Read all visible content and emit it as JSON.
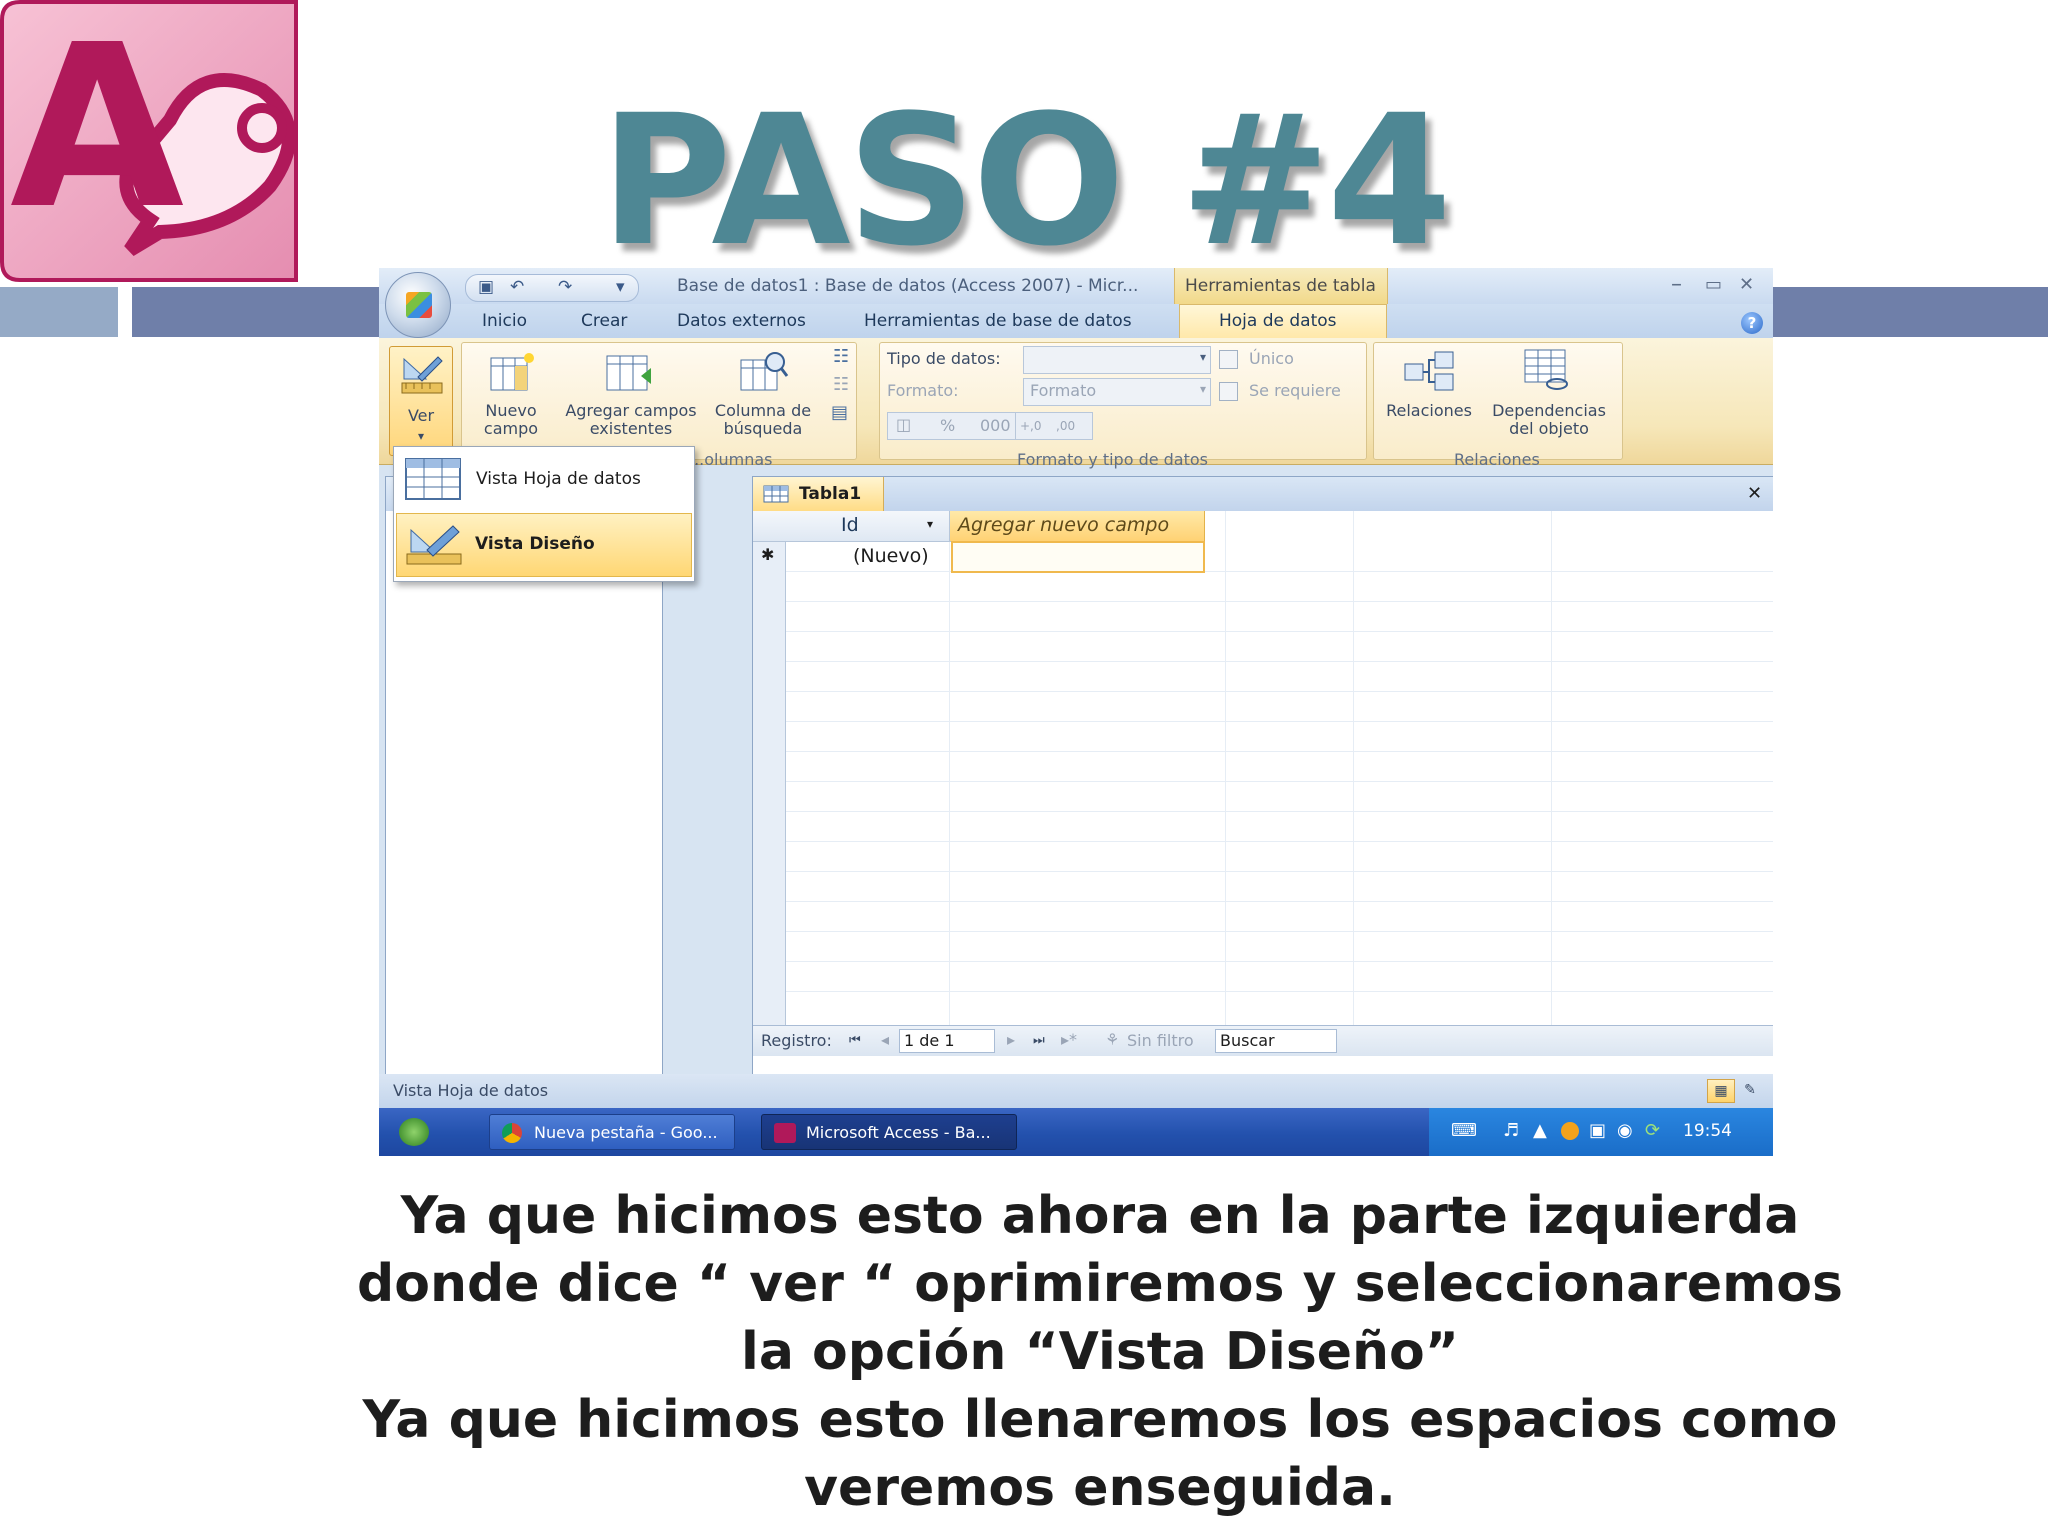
{
  "slide": {
    "title": "PASO #4",
    "caption_lines": [
      "Ya que hicimos esto ahora en la  parte izquierda",
      "donde dice “ ver “ oprimiremos y seleccionaremos",
      "la opción “Vista Diseño”",
      "Ya que hicimos esto llenaremos los espacios como",
      "veremos enseguida."
    ],
    "logo_letter": "A",
    "colors": {
      "title": "#4e8794",
      "band": "#6f7fa9",
      "logo": "#b0195a"
    }
  },
  "window": {
    "title": "Base de datos1 : Base de datos (Access 2007) - Micr...",
    "context_label": "Herramientas de tabla",
    "controls": {
      "minimize": "–",
      "maximize": "▭",
      "close": "✕"
    },
    "qat_icons": [
      "save-icon",
      "undo-icon",
      "redo-icon",
      "customize-icon"
    ]
  },
  "ribbon_tabs": [
    "Inicio",
    "Crear",
    "Datos externos",
    "Herramientas de base de datos",
    "Hoja de datos"
  ],
  "ribbon": {
    "ver": {
      "label": "Ver",
      "arrow": "▾"
    },
    "campos": {
      "nuevo_campo": [
        "Nuevo",
        "campo"
      ],
      "agregar_campos": [
        "Agregar campos",
        "existentes"
      ],
      "columna_busqueda": [
        "Columna de",
        "búsqueda"
      ],
      "group_label": "...olumnas"
    },
    "formato": {
      "tipo_label": "Tipo de datos:",
      "formato_label": "Formato:",
      "formato_value": "Formato",
      "unico": "Único",
      "requerido": "Se requiere",
      "symbols": [
        "%",
        "000",
        "+,0",
        ",00"
      ],
      "group_label": "Formato y tipo de datos"
    },
    "relaciones": {
      "relaciones": "Relaciones",
      "dependencias": [
        "Dependencias",
        "del objeto"
      ],
      "group_label": "Relaciones"
    }
  },
  "ver_menu": {
    "items": [
      "Vista Hoja de datos",
      "Vista Diseño"
    ],
    "selected": "Vista Diseño"
  },
  "nav": {
    "collapse": "«",
    "scroll_up": "⌃"
  },
  "document": {
    "tab_label": "Tabla1",
    "close": "✕",
    "columns": [
      "Id",
      "Agregar nuevo campo"
    ],
    "new_row_marker": "✱",
    "new_row_value": "(Nuevo)",
    "record_nav": {
      "label": "Registro:",
      "first": "⏮",
      "prev": "◂",
      "position": "1 de 1",
      "next": "▸",
      "last": "⏭",
      "new": "▸*"
    },
    "filter": "Sin filtro",
    "search": "Buscar"
  },
  "status": {
    "text": "Vista Hoja de datos"
  },
  "taskbar": {
    "items": [
      "Nueva pestaña - Goo...",
      "Microsoft Access - Ba..."
    ],
    "time": "19:54"
  }
}
